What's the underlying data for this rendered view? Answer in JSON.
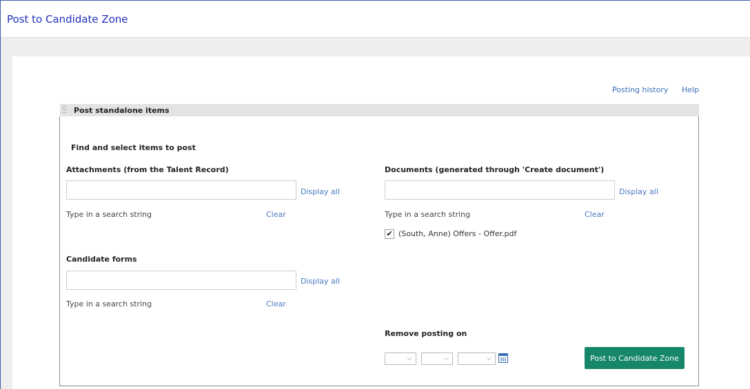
{
  "window": {
    "title": "Post to Candidate Zone"
  },
  "top_links": {
    "posting_history": "Posting history",
    "help": "Help"
  },
  "section": {
    "title": "Post standalone items",
    "find_label": "Find and select items to post",
    "attachments": {
      "label": "Attachments (from the Talent Record)",
      "value": "",
      "display_all": "Display all",
      "hint": "Type in a search string",
      "clear": "Clear"
    },
    "documents": {
      "label": "Documents (generated through 'Create document')",
      "value": "",
      "display_all": "Display all",
      "hint": "Type in a search string",
      "clear": "Clear",
      "selected_item": {
        "label": "(South, Anne) Offers - Offer.pdf",
        "checked": true,
        "check_glyph": "✔"
      }
    },
    "candidate_forms": {
      "label": "Candidate forms",
      "value": "",
      "display_all": "Display all",
      "hint": "Type in a search string",
      "clear": "Clear"
    },
    "remove_posting": {
      "label": "Remove posting on",
      "chevron": "⌵"
    },
    "post_button": "Post to Candidate Zone"
  }
}
